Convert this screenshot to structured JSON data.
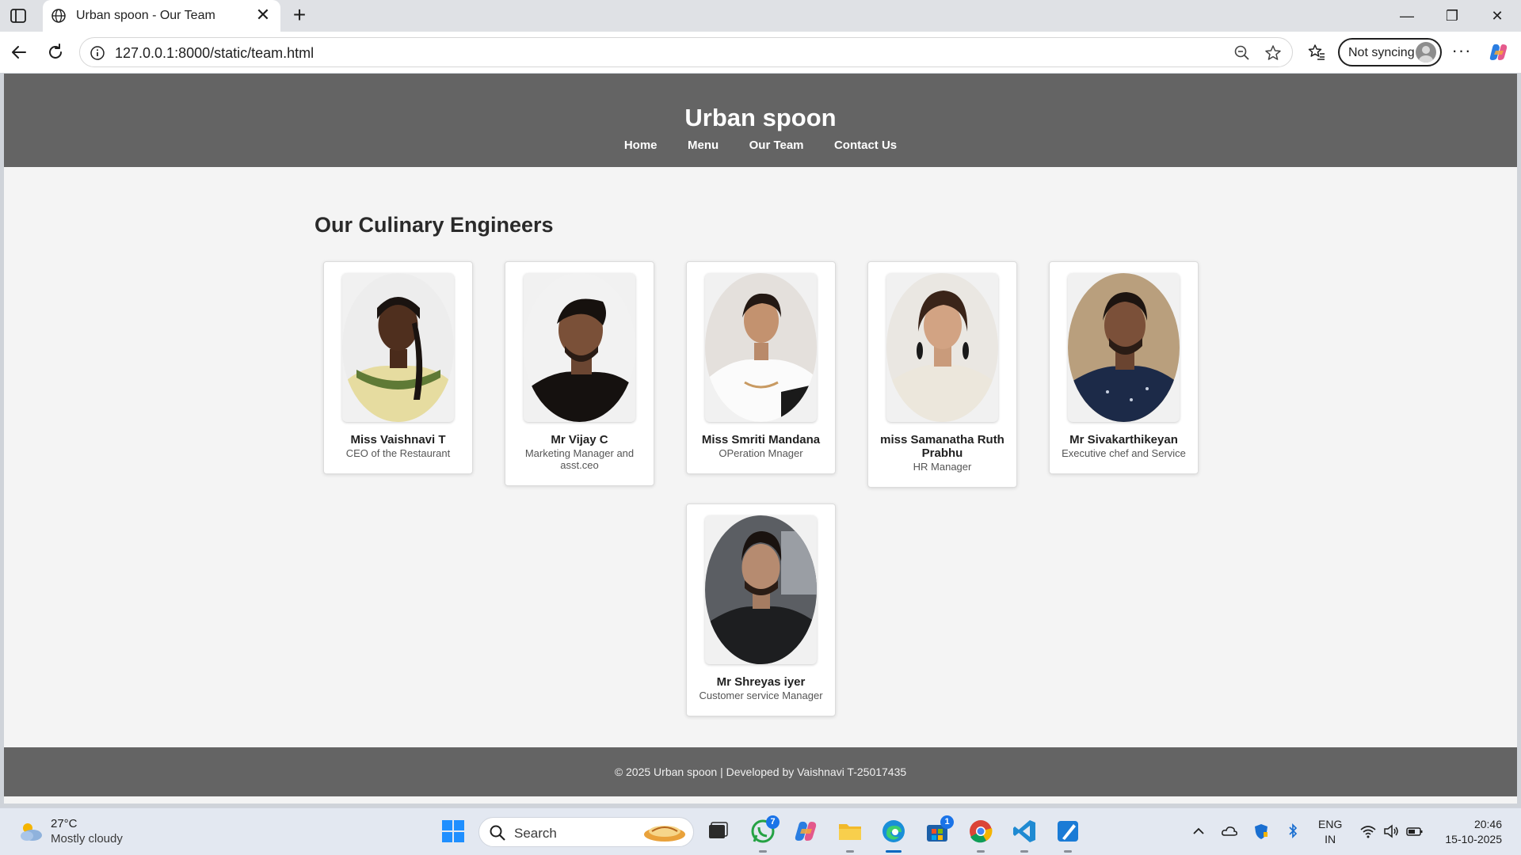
{
  "browser": {
    "tab_title": "Urban spoon - Our Team",
    "new_tab_symbol": "+",
    "close_symbol": "✕",
    "url": "127.0.0.1:8000/static/team.html",
    "sync_label": "Not syncing",
    "more_symbol": "···",
    "window_controls": {
      "minimize": "—",
      "restore": "❐",
      "close": "✕"
    }
  },
  "site": {
    "title": "Urban spoon",
    "nav": [
      "Home",
      "Menu",
      "Our Team",
      "Contact Us"
    ],
    "section_title": "Our Culinary Engineers",
    "team": [
      {
        "name": "Miss Vaishnavi T",
        "role": "CEO of the Restaurant"
      },
      {
        "name": "Mr Vijay C",
        "role": "Marketing Manager and asst.ceo"
      },
      {
        "name": "Miss Smriti Mandana",
        "role": "OPeration Mnager"
      },
      {
        "name": "miss Samanatha Ruth Prabhu",
        "role": "HR Manager"
      },
      {
        "name": "Mr Sivakarthikeyan",
        "role": "Executive chef and Service"
      },
      {
        "name": "Mr Shreyas iyer",
        "role": "Customer service Manager"
      }
    ],
    "footer": "© 2025 Urban spoon | Developed by Vaishnavi T-25017435",
    "colors": {
      "header_bg": "#646464",
      "page_bg": "#f4f4f4",
      "card_bg": "#ffffff"
    }
  },
  "taskbar": {
    "weather_temp": "27°C",
    "weather_desc": "Mostly cloudy",
    "search_label": "Search",
    "whatsapp_badge": "7",
    "store_badge": "1",
    "lang_line1": "ENG",
    "lang_line2": "IN",
    "time": "20:46",
    "date": "15-10-2025"
  }
}
